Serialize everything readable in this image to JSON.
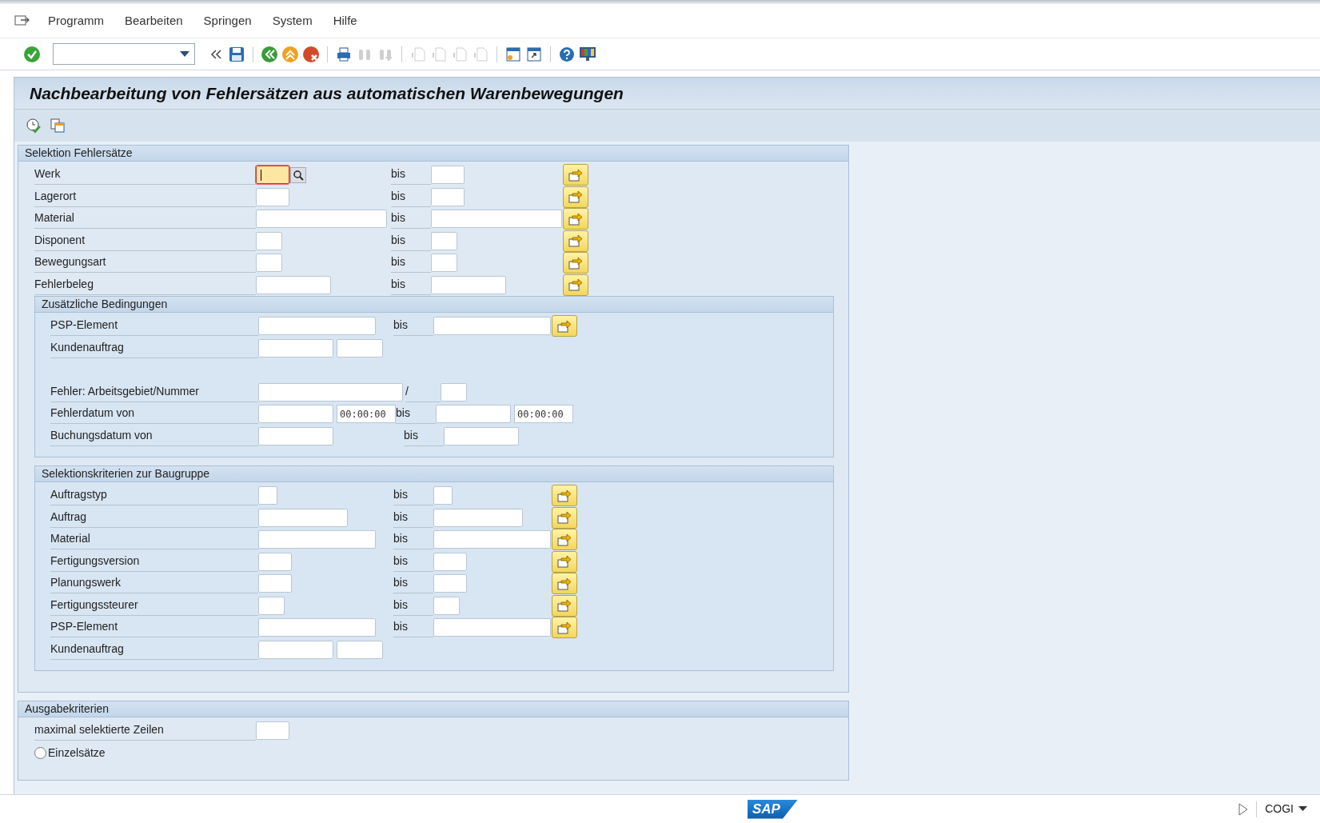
{
  "menu_bar": {
    "items": [
      "Programm",
      "Bearbeiten",
      "Springen",
      "System",
      "Hilfe"
    ]
  },
  "title": "Nachbearbeitung von Fehlersätzen aus automatischen Warenbewegungen",
  "sections": [
    {
      "title": "Selektion Fehlersätze",
      "rows": [
        {
          "kind": "range",
          "label": "Werk",
          "separator": "bis",
          "focused": true,
          "search_help": true
        },
        {
          "kind": "range",
          "label": "Lagerort",
          "separator": "bis",
          "focused": false,
          "search_help": false
        },
        {
          "kind": "range",
          "label": "Material",
          "separator": "bis",
          "focused": false,
          "search_help": false
        },
        {
          "kind": "range",
          "label": "Disponent",
          "separator": "bis",
          "focused": false,
          "search_help": false
        },
        {
          "kind": "range",
          "label": "Bewegungsart",
          "separator": "bis",
          "focused": false,
          "search_help": false
        },
        {
          "kind": "range",
          "label": "Fehlerbeleg",
          "separator": "bis",
          "focused": false,
          "search_help": false
        }
      ],
      "groups": [
        {
          "title": "Zusätzliche Bedingungen",
          "rows": [
            {
              "kind": "range",
              "label": "PSP-Element",
              "separator": "bis",
              "focused": false,
              "search_help": false
            },
            {
              "kind": "pair",
              "label": "Kundenauftrag"
            },
            {
              "kind": "blank"
            },
            {
              "kind": "slash",
              "label": "Fehler: Arbeitsgebiet/Nummer",
              "separator": "/"
            },
            {
              "kind": "datetime",
              "label": "Fehlerdatum von",
              "separator": "bis",
              "low_time": "00:00:00",
              "high_time": "00:00:00"
            },
            {
              "kind": "daterange",
              "label": "Buchungsdatum von",
              "separator": "bis"
            }
          ]
        },
        {
          "title": "Selektionskriterien zur Baugruppe",
          "rows": [
            {
              "kind": "range",
              "label": "Auftragstyp",
              "separator": "bis",
              "focused": false,
              "search_help": false
            },
            {
              "kind": "range",
              "label": "Auftrag",
              "separator": "bis",
              "focused": false,
              "search_help": false
            },
            {
              "kind": "range",
              "label": "Material",
              "separator": "bis",
              "focused": false,
              "search_help": false
            },
            {
              "kind": "range",
              "label": "Fertigungsversion",
              "separator": "bis",
              "focused": false,
              "search_help": false
            },
            {
              "kind": "range",
              "label": "Planungswerk",
              "separator": "bis",
              "focused": false,
              "search_help": false
            },
            {
              "kind": "range",
              "label": "Fertigungssteurer",
              "separator": "bis",
              "focused": false,
              "search_help": false
            },
            {
              "kind": "range",
              "label": "PSP-Element",
              "separator": "bis",
              "focused": false,
              "search_help": false
            },
            {
              "kind": "pair",
              "label": "Kundenauftrag"
            }
          ]
        }
      ]
    },
    {
      "title": "Ausgabekriterien",
      "rows": [
        {
          "kind": "single",
          "label": "maximal selektierte Zeilen"
        },
        {
          "kind": "radio",
          "label": "Einzelsätze",
          "selected": false
        }
      ]
    }
  ],
  "status_bar": {
    "logo": "SAP",
    "transaction": "COGI"
  }
}
